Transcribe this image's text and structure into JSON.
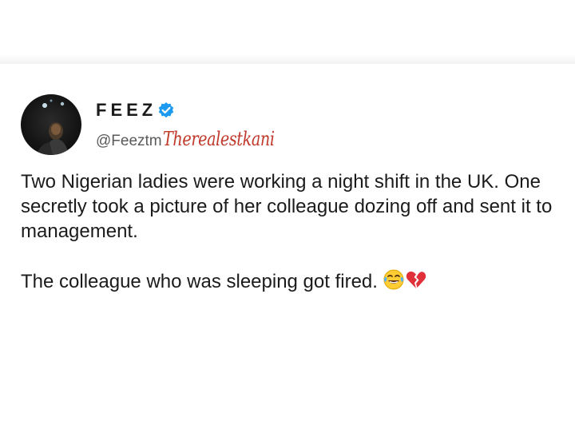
{
  "tweet": {
    "display_name": "FEEZ",
    "handle": "@Feeztm",
    "watermark": "Therealestkani",
    "paragraphs": [
      "Two Nigerian ladies were working a night shift in the UK. One secretly took a picture of her colleague dozing off and sent it to management.",
      "The colleague who was sleeping got fired."
    ],
    "emojis": [
      "face-with-tears-of-joy-icon",
      "broken-heart-icon"
    ]
  },
  "colors": {
    "text": "#1b1b1b",
    "handle": "#5a5a5a",
    "verified": "#1d9bf0",
    "watermark": "#c0392b"
  }
}
